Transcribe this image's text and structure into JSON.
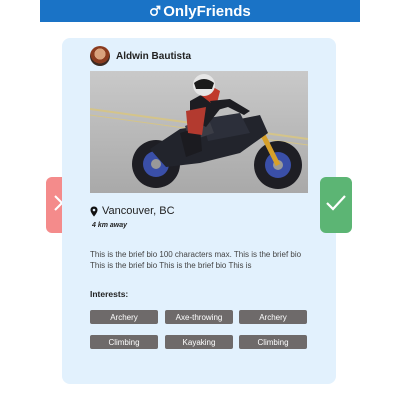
{
  "header": {
    "title": "OnlyFriends",
    "logo_icon": "male-symbol-icon"
  },
  "profile": {
    "name": "Aldwin Bautista",
    "location": "Vancouver, BC",
    "distance": "4 km away",
    "bio": "This is the brief bio 100 characters max. This is the brief bio This is the brief bio This is the brief bio This is",
    "interests_label": "Interests:",
    "interests": [
      "Archery",
      "Axe-throwing",
      "Archery",
      "Climbing",
      "Kayaking",
      "Climbing"
    ]
  },
  "actions": {
    "reject_icon": "close-icon",
    "accept_icon": "checkmark-icon"
  },
  "colors": {
    "header": "#1a73c6",
    "card": "#e2f1fd",
    "reject": "#f48b8b",
    "accept": "#5cb574",
    "chip": "#6e6a6a"
  }
}
